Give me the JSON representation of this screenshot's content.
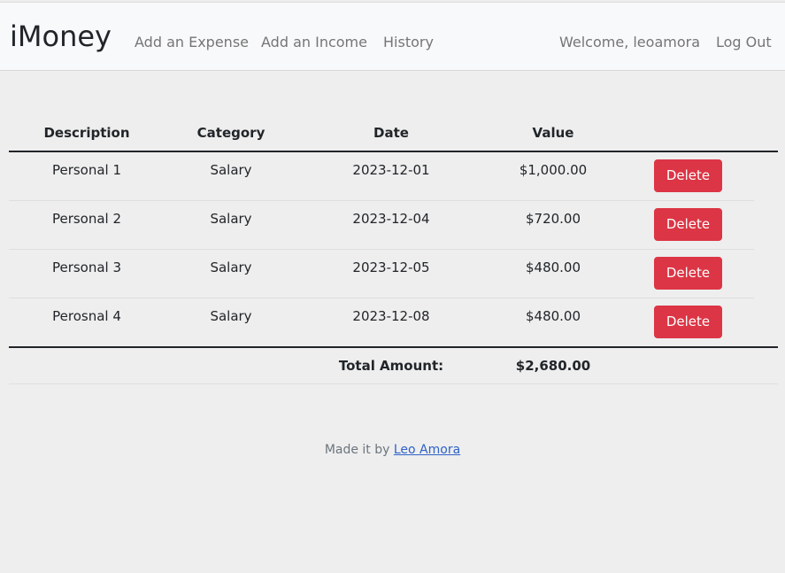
{
  "navbar": {
    "brand": "iMoney",
    "links": {
      "add_expense": "Add an Expense",
      "add_income": "Add an Income",
      "history": "History"
    },
    "welcome": "Welcome, leoamora",
    "logout": "Log Out"
  },
  "table": {
    "headers": {
      "description": "Description",
      "category": "Category",
      "date": "Date",
      "value": "Value"
    },
    "rows": [
      {
        "description": "Personal 1",
        "category": "Salary",
        "date": "2023-12-01",
        "value": "$1,000.00",
        "action": "Delete"
      },
      {
        "description": "Personal 2",
        "category": "Salary",
        "date": "2023-12-04",
        "value": "$720.00",
        "action": "Delete"
      },
      {
        "description": "Personal 3",
        "category": "Salary",
        "date": "2023-12-05",
        "value": "$480.00",
        "action": "Delete"
      },
      {
        "description": "Perosnal 4",
        "category": "Salary",
        "date": "2023-12-08",
        "value": "$480.00",
        "action": "Delete"
      }
    ],
    "total_label": "Total Amount:",
    "total_value": "$2,680.00"
  },
  "footer": {
    "prefix": "Made it by",
    "author": "Leo Amora"
  },
  "colors": {
    "danger": "#dc3545",
    "navbar_bg": "#f8f9fa",
    "page_bg": "#eeeeee",
    "link": "#2f62c8"
  }
}
